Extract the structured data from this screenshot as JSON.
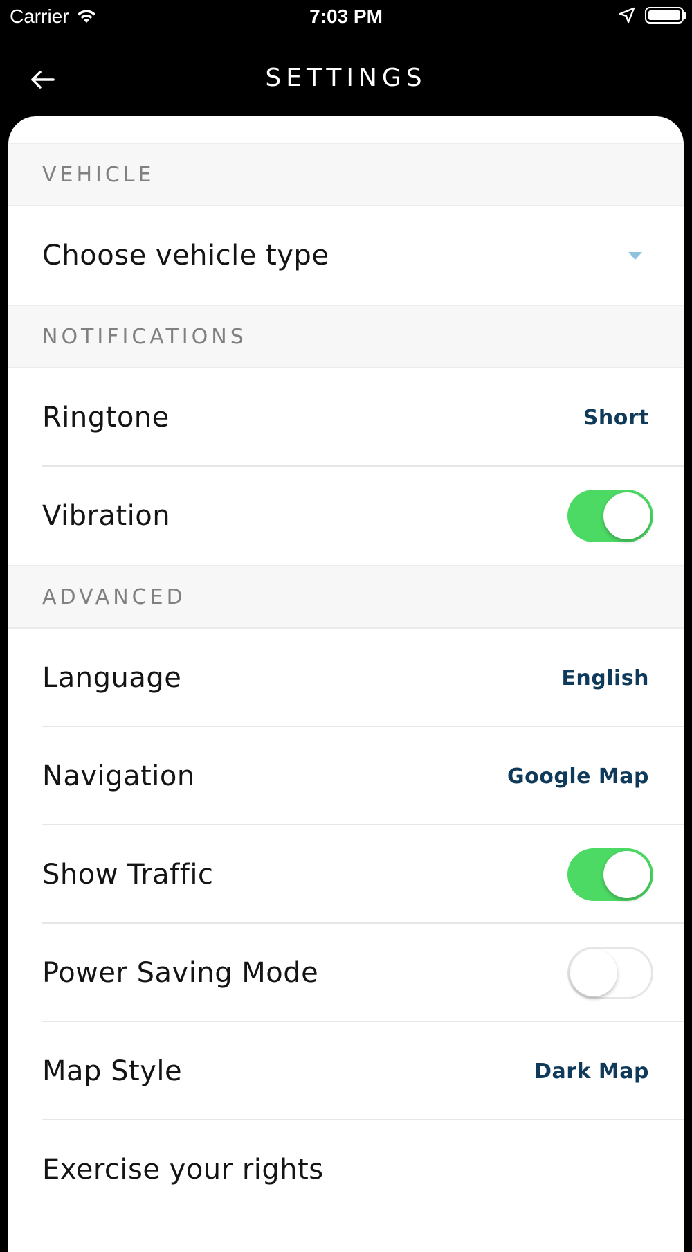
{
  "status_bar": {
    "carrier": "Carrier",
    "time": "7:03 PM"
  },
  "header": {
    "title": "SETTINGS",
    "back_icon": "arrow-left-icon"
  },
  "sections": {
    "vehicle": {
      "title": "VEHICLE",
      "vehicle_type": {
        "label": "Choose vehicle type",
        "icon": "chevron-down-icon"
      }
    },
    "notifications": {
      "title": "NOTIFICATIONS",
      "ringtone": {
        "label": "Ringtone",
        "value": "Short"
      },
      "vibration": {
        "label": "Vibration",
        "enabled": true
      }
    },
    "advanced": {
      "title": "ADVANCED",
      "language": {
        "label": "Language",
        "value": "English"
      },
      "navigation": {
        "label": "Navigation",
        "value": "Google Map"
      },
      "show_traffic": {
        "label": "Show Traffic",
        "enabled": true
      },
      "power_saving": {
        "label": "Power Saving Mode",
        "enabled": false
      },
      "map_style": {
        "label": "Map Style",
        "value": "Dark Map"
      },
      "exercise_rights": {
        "label": "Exercise your rights"
      }
    }
  },
  "colors": {
    "toggle_on": "#4cd964",
    "value_text": "#0f3a5a",
    "dropdown_arrow": "#8ec3de",
    "section_header_bg": "#f7f7f7"
  }
}
